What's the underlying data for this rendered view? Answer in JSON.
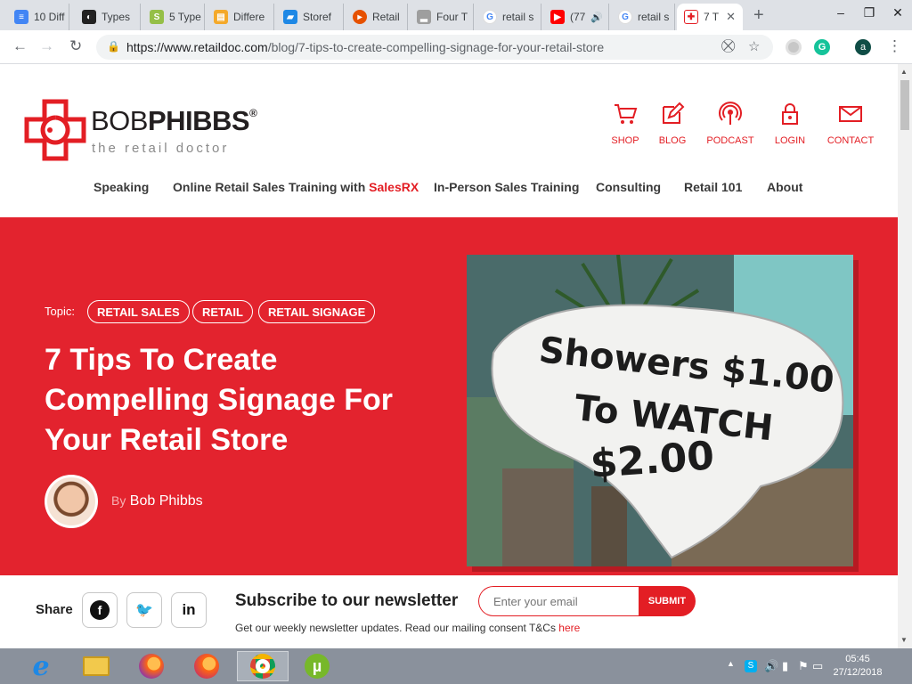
{
  "browser": {
    "tabs": [
      {
        "title": "10 Diff",
        "favicon": "docs-icon",
        "color": "#4285f4"
      },
      {
        "title": "Types",
        "favicon": "types-icon",
        "color": "#222222"
      },
      {
        "title": "5 Type",
        "favicon": "shopify-icon",
        "color": "#95bf47"
      },
      {
        "title": "Differe",
        "favicon": "differ-icon",
        "color": "#f4a92a"
      },
      {
        "title": "Storef",
        "favicon": "storefront-icon",
        "color": "#1e88e5"
      },
      {
        "title": "Retail",
        "favicon": "retail-icon",
        "color": "#e65100"
      },
      {
        "title": "Four T",
        "favicon": "four-icon",
        "color": "#9e9e9e"
      },
      {
        "title": "retail s",
        "favicon": "google-icon",
        "color": "#4285f4"
      },
      {
        "title": "(77",
        "favicon": "youtube-icon",
        "color": "#ff0000"
      },
      {
        "title": "retail s",
        "favicon": "google-icon",
        "color": "#4285f4"
      },
      {
        "title": "7 T",
        "favicon": "retaildoc-icon",
        "color": "#e31e24"
      }
    ],
    "new_tab": "+",
    "window_controls": {
      "minimize": "–",
      "restore": "❐",
      "close": "✕"
    },
    "url_domain": "https://www.retaildoc.com",
    "url_path": "/blog/7-tips-to-create-compelling-signage-for-your-retail-store",
    "profile_initial": "a"
  },
  "site": {
    "logo": {
      "brand_light": "BOB",
      "brand_bold": "PHIBBS",
      "registered": "®",
      "tagline": "the retail doctor"
    },
    "utility_nav": [
      {
        "label": "SHOP",
        "icon": "cart-icon"
      },
      {
        "label": "BLOG",
        "icon": "pencil-icon"
      },
      {
        "label": "PODCAST",
        "icon": "podcast-icon"
      },
      {
        "label": "LOGIN",
        "icon": "lock-icon"
      },
      {
        "label": "CONTACT",
        "icon": "envelope-icon"
      }
    ],
    "main_nav": {
      "speaking": "Speaking",
      "online_prefix": "Online Retail Sales Training with ",
      "online_brand": "SalesRX",
      "in_person": "In-Person Sales Training",
      "consulting": "Consulting",
      "retail101": "Retail 101",
      "about": "About"
    }
  },
  "article": {
    "topic_label": "Topic:",
    "topics": [
      "RETAIL SALES",
      "RETAIL",
      "RETAIL SIGNAGE"
    ],
    "title": "7 Tips To Create Compelling Signage For Your Retail Store",
    "by": "By",
    "author": "Bob Phibbs",
    "image_sign_lines": [
      "Showers $1.00",
      "To WATCH",
      "$2.00"
    ]
  },
  "share": {
    "label": "Share",
    "networks": [
      {
        "glyph": "f",
        "icon": "facebook-icon"
      },
      {
        "glyph": "🐦",
        "icon": "twitter-icon"
      },
      {
        "glyph": "in",
        "icon": "linkedin-icon"
      }
    ]
  },
  "newsletter": {
    "title": "Subscribe to our newsletter",
    "placeholder": "Enter your email",
    "submit": "SUBMIT",
    "subtitle": "Get our weekly newsletter updates. Read our mailing consent T&Cs ",
    "link": "here"
  },
  "taskbar": {
    "time": "05:45",
    "date": "27/12/2018"
  },
  "colors": {
    "brand_red": "#e31e24",
    "hero_red": "#e3232e"
  }
}
